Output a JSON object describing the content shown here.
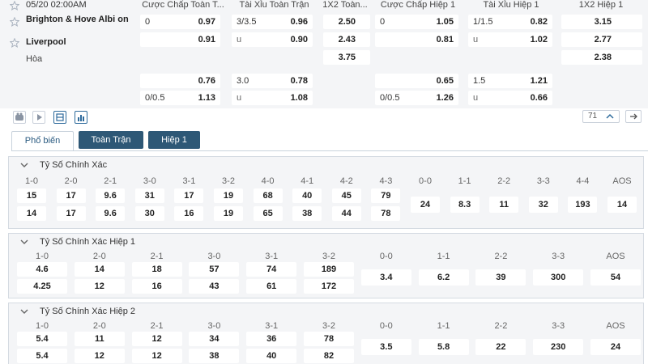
{
  "match": {
    "time": "05/20 02:00AM",
    "home": "Brighton & Hove Albi on",
    "away": "Liverpool",
    "draw": "Hòa",
    "headers": [
      "Cược Chấp Toàn T...",
      "Tài Xỉu Toàn Trận",
      "1X2 Toàn...",
      "Cược Chấp Hiệp 1",
      "Tài Xỉu Hiệp 1",
      "1X2 Hiệp 1"
    ],
    "main": {
      "ah_ft": {
        "hdp": "0",
        "home": "0.97",
        "away": "0.91"
      },
      "ou_ft": {
        "line": "3/3.5",
        "over": "0.96",
        "under_label": "u",
        "under": "0.90"
      },
      "x12_ft": {
        "home": "2.50",
        "away": "2.43",
        "draw": "3.75"
      },
      "ah_h1": {
        "hdp": "0",
        "home": "1.05",
        "away": "0.81"
      },
      "ou_h1": {
        "line": "1/1.5",
        "over": "0.82",
        "under_label": "u",
        "under": "1.02"
      },
      "x12_h1": {
        "home": "3.15",
        "away": "2.77",
        "draw": "2.38"
      }
    },
    "alt": {
      "ah_ft": {
        "home": "0.76",
        "hdp": "0/0.5",
        "away": "1.13"
      },
      "ou_ft": {
        "line": "3.0",
        "over": "0.78",
        "under_label": "u",
        "under": "1.08"
      },
      "ah_h1": {
        "home": "0.65",
        "hdp": "0/0.5",
        "away": "1.26"
      },
      "ou_h1": {
        "line": "1.5",
        "over": "1.21",
        "under_label": "u",
        "under": "0.66"
      }
    }
  },
  "toolbar": {
    "count": "71"
  },
  "tabs": [
    "Phổ biến",
    "Toàn Trận",
    "Hiệp 1"
  ],
  "sections": [
    {
      "title": "Tỷ Số Chính Xác",
      "scores": [
        "1-0",
        "2-0",
        "2-1",
        "3-0",
        "3-1",
        "3-2",
        "4-0",
        "4-1",
        "4-2",
        "4-3",
        "0-0",
        "1-1",
        "2-2",
        "3-3",
        "4-4",
        "AOS"
      ],
      "home": [
        "15",
        "17",
        "9.6",
        "31",
        "17",
        "19",
        "68",
        "40",
        "45",
        "79"
      ],
      "away": [
        "14",
        "17",
        "9.6",
        "30",
        "16",
        "19",
        "65",
        "38",
        "44",
        "78"
      ],
      "draws": [
        "24",
        "8.3",
        "11",
        "32",
        "193",
        "14"
      ]
    },
    {
      "title": "Tỷ Số Chính Xác Hiệp 1",
      "scores": [
        "1-0",
        "2-0",
        "2-1",
        "3-0",
        "3-1",
        "3-2",
        "0-0",
        "1-1",
        "2-2",
        "3-3",
        "AOS"
      ],
      "home": [
        "4.6",
        "14",
        "18",
        "57",
        "74",
        "189"
      ],
      "away": [
        "4.25",
        "12",
        "16",
        "43",
        "61",
        "172"
      ],
      "draws": [
        "3.4",
        "6.2",
        "39",
        "300",
        "54"
      ]
    },
    {
      "title": "Tỷ Số Chính Xác Hiệp 2",
      "scores": [
        "1-0",
        "2-0",
        "2-1",
        "3-0",
        "3-1",
        "3-2",
        "0-0",
        "1-1",
        "2-2",
        "3-3",
        "AOS"
      ],
      "home": [
        "5.4",
        "11",
        "12",
        "34",
        "36",
        "78"
      ],
      "away": [
        "5.4",
        "12",
        "12",
        "38",
        "40",
        "82"
      ],
      "draws": [
        "3.5",
        "5.8",
        "22",
        "230",
        "24"
      ]
    }
  ]
}
